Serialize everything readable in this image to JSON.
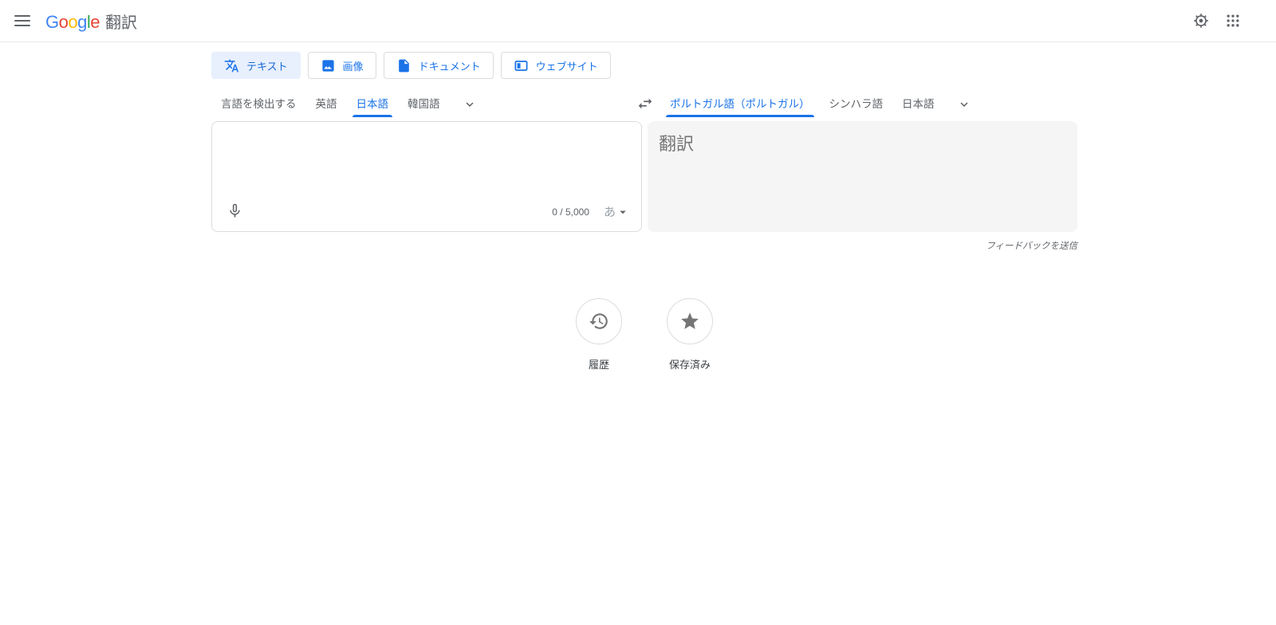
{
  "header": {
    "logo": {
      "letters": [
        {
          "ch": "G",
          "color": "#4285F4"
        },
        {
          "ch": "o",
          "color": "#EA4335"
        },
        {
          "ch": "o",
          "color": "#FBBC05"
        },
        {
          "ch": "g",
          "color": "#4285F4"
        },
        {
          "ch": "l",
          "color": "#34A853"
        },
        {
          "ch": "e",
          "color": "#EA4335"
        }
      ],
      "product_title": "翻訳"
    }
  },
  "mode_tabs": [
    {
      "label": "テキスト",
      "selected": true
    },
    {
      "label": "画像",
      "selected": false
    },
    {
      "label": "ドキュメント",
      "selected": false
    },
    {
      "label": "ウェブサイト",
      "selected": false
    }
  ],
  "source_languages": {
    "items": [
      {
        "label": "言語を検出する",
        "selected": false
      },
      {
        "label": "英語",
        "selected": false
      },
      {
        "label": "日本語",
        "selected": true
      },
      {
        "label": "韓国語",
        "selected": false
      }
    ]
  },
  "target_languages": {
    "items": [
      {
        "label": "ポルトガル語（ポルトガル）",
        "selected": true
      },
      {
        "label": "シンハラ語",
        "selected": false
      },
      {
        "label": "日本語",
        "selected": false
      }
    ]
  },
  "source_panel": {
    "text": "",
    "char_counter": "0 / 5,000",
    "input_tool_label": "あ"
  },
  "target_panel": {
    "placeholder": "翻訳"
  },
  "feedback_link": "フィードバックを送信",
  "shortcuts": [
    {
      "label": "履歴"
    },
    {
      "label": "保存済み"
    }
  ],
  "colors": {
    "accent_blue": "#1a73e8",
    "selected_mode_tab_bg": "#e8f0fe",
    "selected_mode_tab_text": "#1967d2",
    "text_gray": "#5f6368",
    "icon_gray": "#757575",
    "border_gray": "#dadce0",
    "output_panel_bg": "#f5f5f5"
  }
}
